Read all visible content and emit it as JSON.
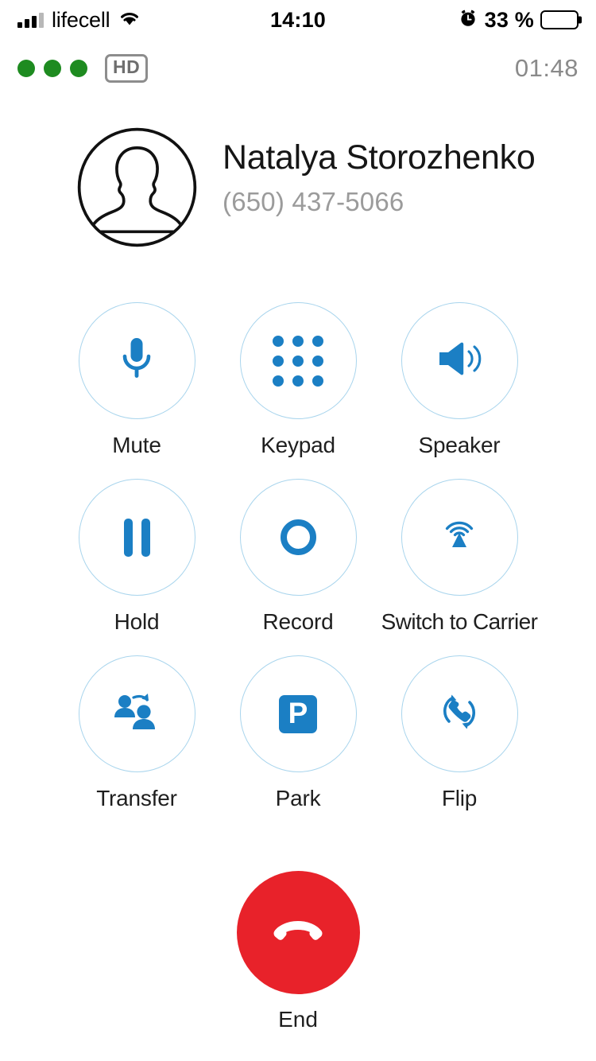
{
  "status_bar": {
    "carrier": "lifecell",
    "signal_icon": "signal-bars-icon",
    "wifi_icon": "wifi-icon",
    "time": "14:10",
    "alarm_icon": "alarm-clock-icon",
    "battery_percent": "33 %",
    "battery_level": 33,
    "battery_icon": "battery-icon"
  },
  "call_bar": {
    "quality_dots_count": 3,
    "quality_dot_color": "#1e8b20",
    "hd_badge": "HD",
    "timer": "01:48"
  },
  "contact": {
    "avatar_icon": "person-avatar-icon",
    "name": "Natalya Storozhenko",
    "phone": "(650) 437-5066"
  },
  "controls": [
    [
      {
        "label": "Mute",
        "icon": "microphone-icon"
      },
      {
        "label": "Keypad",
        "icon": "keypad-icon"
      },
      {
        "label": "Speaker",
        "icon": "speaker-icon"
      }
    ],
    [
      {
        "label": "Hold",
        "icon": "pause-icon"
      },
      {
        "label": "Record",
        "icon": "record-circle-icon"
      },
      {
        "label": "Switch to Carrier",
        "icon": "broadcast-tower-icon"
      }
    ],
    [
      {
        "label": "Transfer",
        "icon": "transfer-people-icon"
      },
      {
        "label": "Park",
        "icon": "park-p-icon"
      },
      {
        "label": "Flip",
        "icon": "flip-phone-icon"
      }
    ]
  ],
  "end_call": {
    "label": "End",
    "icon": "hangup-phone-icon",
    "color": "#e8222a"
  },
  "theme": {
    "accent_blue": "#1b7fc4",
    "circle_border": "#a9d5ed",
    "text_primary": "#1f1f1f",
    "text_muted": "#9b9b9b",
    "background": "#ffffff"
  }
}
